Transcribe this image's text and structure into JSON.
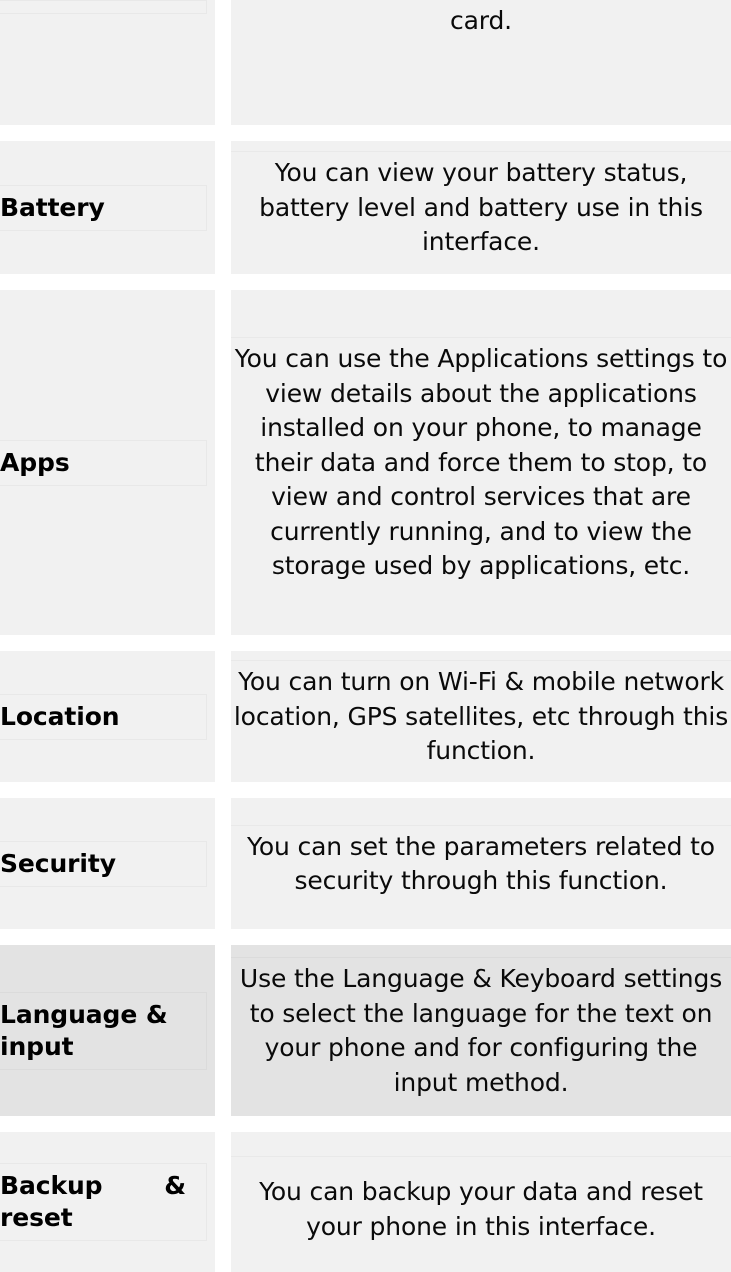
{
  "document": {
    "type": "two-column-definition-table",
    "colors": {
      "cell_background": "#F1F1F1",
      "highlight_row_background": "#E3E3E3",
      "page_background": "#FFFFFF",
      "text": "#000000"
    },
    "columns": {
      "term_header": "",
      "definition_header": ""
    }
  },
  "rows": [
    {
      "term": "",
      "definition": "card.",
      "clipped": "top",
      "highlighted": false
    },
    {
      "term": "Battery",
      "definition": "You can view your battery status, battery level and battery use in this interface.",
      "highlighted": false
    },
    {
      "term": "Apps",
      "definition": "You can use the Applications settings to view details about the applications installed on your phone, to manage their data and force them to stop, to view and control services that are currently running, and to view the storage used by applications, etc.",
      "highlighted": false
    },
    {
      "term": "Location",
      "definition": "You can turn on Wi-Fi & mobile network location, GPS satellites, etc through this function.",
      "highlighted": false
    },
    {
      "term": "Security",
      "definition": "You can set the parameters related to security through this function.",
      "highlighted": false
    },
    {
      "term": "Language & input",
      "definition": "Use the Language & Keyboard settings to select the language for the text on your phone and for configuring the input method.",
      "highlighted": true
    },
    {
      "term_part_1": "Backup",
      "term_part_2": "&",
      "term_part_3": "reset",
      "term": "Backup & reset",
      "definition": "You can backup your data and reset your phone in this interface.",
      "clipped": "bottom",
      "highlighted": false
    }
  ]
}
